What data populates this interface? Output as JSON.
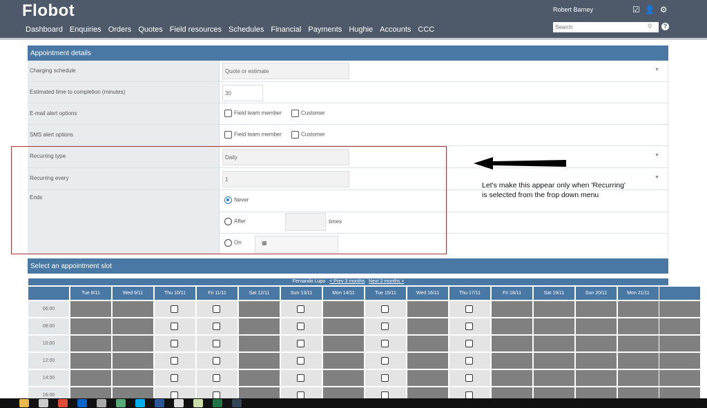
{
  "header": {
    "logo": "Flobot",
    "user": "Robert Barney",
    "search_placeholder": "Search",
    "help": "?",
    "nav": [
      "Dashboard",
      "Enquiries",
      "Orders",
      "Quotes",
      "Field resources",
      "Schedules",
      "Financial",
      "Payments",
      "Hughie",
      "Accounts",
      "CCC"
    ]
  },
  "details": {
    "title": "Appointment details",
    "charging_label": "Charging schedule",
    "charging_value": "Quote or estimate",
    "etc_label": "Estimated time to completion (minutes)",
    "etc_value": "30",
    "email_label": "E-mail alert options",
    "sms_label": "SMS alert options",
    "opt_field": "Field team member",
    "opt_customer": "Customer",
    "rtype_label": "Recurring type",
    "rtype_value": "Daily",
    "revery_label": "Recurring every",
    "revery_value": "1",
    "ends_label": "Ends",
    "never": "Never",
    "after": "After",
    "times": "times",
    "on": "On",
    "ends_selected": "Never"
  },
  "slots": {
    "title": "Select an appointment slot",
    "person": "Fernando Lupo",
    "prev": "< Prev 3 months",
    "next": "Next 3 months >",
    "days": [
      "Tue 8/11",
      "Wed 9/11",
      "Thu 10/11",
      "Fri 11/11",
      "Sat 12/11",
      "Sun 13/11",
      "Mon 14/11",
      "Tue 15/11",
      "Wed 16/11",
      "Thu 17/11",
      "Fri 18/11",
      "Sat 19/11",
      "Sun 20/11",
      "Mon 21/11"
    ],
    "available": [
      false,
      false,
      true,
      true,
      false,
      true,
      false,
      true,
      false,
      true,
      false,
      false,
      false,
      false
    ],
    "times": [
      "06:00",
      "08:00",
      "10:00",
      "12:00",
      "14:00",
      "16:00"
    ]
  },
  "annotation": {
    "line1": "Let's make this appear only when 'Recurring'",
    "line2": "is selected from the frop down menu",
    "color": "#aa3333"
  }
}
